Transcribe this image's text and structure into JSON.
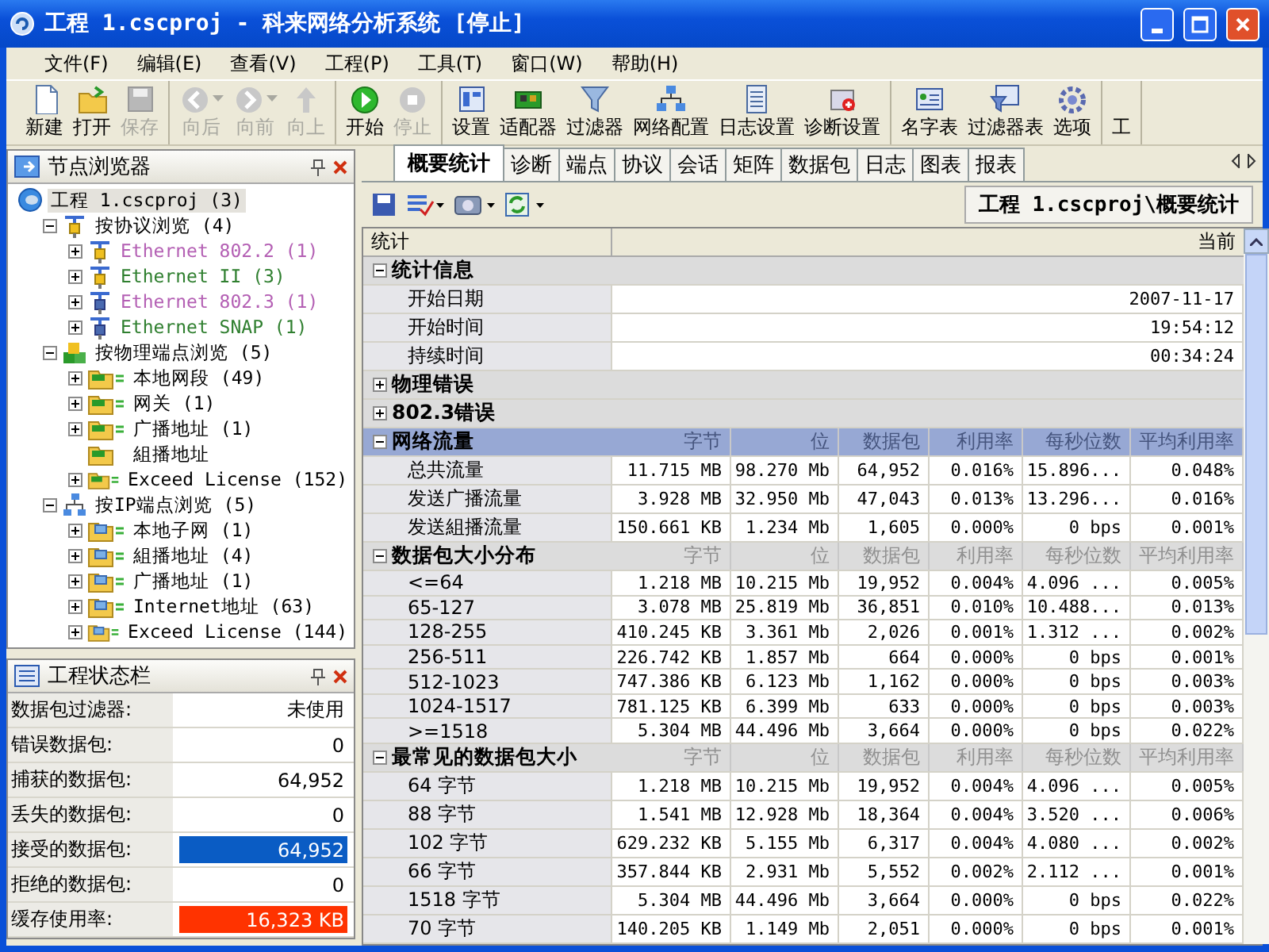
{
  "window": {
    "title": "工程 1.cscproj - 科来网络分析系统 [停止]"
  },
  "menu": [
    "文件(F)",
    "编辑(E)",
    "查看(V)",
    "工程(P)",
    "工具(T)",
    "窗口(W)",
    "帮助(H)"
  ],
  "toolbar": [
    [
      {
        "label": "新建",
        "kind": "new",
        "disabled": false,
        "dropdown": false
      },
      {
        "label": "打开",
        "kind": "open",
        "disabled": false,
        "dropdown": false
      },
      {
        "label": "保存",
        "kind": "save",
        "disabled": true,
        "dropdown": false
      }
    ],
    [
      {
        "label": "向后",
        "kind": "back",
        "disabled": true,
        "dropdown": true
      },
      {
        "label": "向前",
        "kind": "forward",
        "disabled": true,
        "dropdown": true
      },
      {
        "label": "向上",
        "kind": "up",
        "disabled": true,
        "dropdown": false
      }
    ],
    [
      {
        "label": "开始",
        "kind": "start",
        "disabled": false,
        "dropdown": false
      },
      {
        "label": "停止",
        "kind": "stop",
        "disabled": true,
        "dropdown": false
      }
    ],
    [
      {
        "label": "设置",
        "kind": "settings",
        "disabled": false,
        "dropdown": false
      },
      {
        "label": "适配器",
        "kind": "adapter",
        "disabled": false,
        "dropdown": false
      },
      {
        "label": "过滤器",
        "kind": "filter",
        "disabled": false,
        "dropdown": false
      },
      {
        "label": "网络配置",
        "kind": "network",
        "disabled": false,
        "dropdown": false
      },
      {
        "label": "日志设置",
        "kind": "log",
        "disabled": false,
        "dropdown": false
      },
      {
        "label": "诊断设置",
        "kind": "diagnosis",
        "disabled": false,
        "dropdown": false
      }
    ],
    [
      {
        "label": "名字表",
        "kind": "names",
        "disabled": false,
        "dropdown": false
      },
      {
        "label": "过滤器表",
        "kind": "filtertable",
        "disabled": false,
        "dropdown": false
      },
      {
        "label": "选项",
        "kind": "options",
        "disabled": false,
        "dropdown": false
      }
    ],
    [
      {
        "label": "工",
        "kind": "none",
        "disabled": false,
        "dropdown": false
      }
    ]
  ],
  "node_browser": {
    "title": "节点浏览器",
    "nodes": [
      {
        "label": "工程 1.cscproj (3)",
        "kind": "project",
        "selected": true,
        "children": [
          {
            "label": "按协议浏览 (4)",
            "kind": "protocol",
            "expanded": true,
            "selected": false,
            "children": [
              {
                "label": "Ethernet 802.2 (1)",
                "kind": "protocol",
                "color": "#b460b4",
                "expanded": false,
                "selected": false
              },
              {
                "label": "Ethernet II (3)",
                "kind": "protocol",
                "color": "#2f7f2f",
                "expanded": false,
                "selected": false
              },
              {
                "label": "Ethernet 802.3 (1)",
                "kind": "protocol-blue",
                "color": "#b460b4",
                "expanded": false,
                "selected": false
              },
              {
                "label": "Ethernet SNAP (1)",
                "kind": "protocol-blue",
                "color": "#2f7f2f",
                "expanded": false,
                "selected": false
              }
            ]
          },
          {
            "label": "按物理端点浏览 (5)",
            "kind": "physical",
            "expanded": true,
            "selected": false,
            "children": [
              {
                "label": "本地网段 (49)",
                "kind": "board-folder",
                "expanded": false,
                "selected": false
              },
              {
                "label": "网关 (1)",
                "kind": "board-folder",
                "expanded": false,
                "selected": false
              },
              {
                "label": "广播地址 (1)",
                "kind": "board-folder",
                "expanded": false,
                "selected": false
              },
              {
                "label": "組播地址",
                "kind": "board-folder-plain",
                "selected": false
              },
              {
                "label": "Exceed License (152)",
                "kind": "board-folder",
                "expanded": false,
                "selected": false
              }
            ]
          },
          {
            "label": "按IP端点浏览 (5)",
            "kind": "ip",
            "expanded": true,
            "selected": false,
            "children": [
              {
                "label": "本地子网 (1)",
                "kind": "pc-folder",
                "expanded": false,
                "selected": false
              },
              {
                "label": "組播地址 (4)",
                "kind": "pc-folder",
                "expanded": false,
                "selected": false
              },
              {
                "label": "广播地址 (1)",
                "kind": "pc-folder",
                "expanded": false,
                "selected": false
              },
              {
                "label": "Internet地址 (63)",
                "kind": "pc-folder",
                "expanded": false,
                "selected": false
              },
              {
                "label": "Exceed License (144)",
                "kind": "pc-folder",
                "expanded": false,
                "selected": false
              }
            ]
          }
        ]
      }
    ]
  },
  "status_panel": {
    "title": "工程状态栏",
    "rows": [
      {
        "label": "数据包过滤器:",
        "value": "未使用"
      },
      {
        "label": "错误数据包:",
        "value": "0"
      },
      {
        "label": "捕获的数据包:",
        "value": "64,952"
      },
      {
        "label": "丢失的数据包:",
        "value": "0"
      },
      {
        "label": "接受的数据包:",
        "value": "64,952",
        "color": "#0a5cc4"
      },
      {
        "label": "拒绝的数据包:",
        "value": "0"
      },
      {
        "label": "缓存使用率:",
        "value": "16,323 KB",
        "color": "#ff3300"
      }
    ]
  },
  "tabs": [
    {
      "label": "概要统计",
      "selected": true
    },
    {
      "label": "诊断",
      "selected": false
    },
    {
      "label": "端点",
      "selected": false
    },
    {
      "label": "协议",
      "selected": false
    },
    {
      "label": "会话",
      "selected": false
    },
    {
      "label": "矩阵",
      "selected": false
    },
    {
      "label": "数据包",
      "selected": false
    },
    {
      "label": "日志",
      "selected": false
    },
    {
      "label": "图表",
      "selected": false
    },
    {
      "label": "报表",
      "selected": false
    }
  ],
  "breadcrumb": "工程 1.cscproj\\概要统计",
  "table": {
    "columns": [
      "统计",
      "当前"
    ],
    "groups": [
      {
        "label": "统计信息",
        "kind": "info",
        "expanded": true,
        "selected": false,
        "rows": [
          {
            "name": "开始日期",
            "values": [
              "2007-11-17"
            ]
          },
          {
            "name": "开始时间",
            "values": [
              "19:54:12"
            ]
          },
          {
            "name": "持续时间",
            "values": [
              "00:34:24"
            ]
          }
        ]
      },
      {
        "label": "物理错误",
        "kind": "info",
        "expanded": false,
        "selected": false
      },
      {
        "label": "802.3错误",
        "kind": "info",
        "expanded": false,
        "selected": false
      },
      {
        "label": "网络流量",
        "kind": "metrics",
        "expanded": true,
        "selected": true,
        "headers": [
          "字节",
          "位",
          "数据包",
          "利用率",
          "每秒位数",
          "平均利用率"
        ],
        "rows": [
          {
            "name": "总共流量",
            "values": [
              "11.715 MB",
              "98.270 Mb",
              "64,952",
              "0.016%",
              "15.896...",
              "0.048%"
            ]
          },
          {
            "name": "发送广播流量",
            "values": [
              "3.928 MB",
              "32.950 Mb",
              "47,043",
              "0.013%",
              "13.296...",
              "0.016%"
            ]
          },
          {
            "name": "发送組播流量",
            "values": [
              "150.661 KB",
              "1.234 Mb",
              "1,605",
              "0.000%",
              "0 bps",
              "0.001%"
            ]
          }
        ]
      },
      {
        "label": "数据包大小分布",
        "kind": "metrics",
        "expanded": true,
        "selected": false,
        "headers": [
          "字节",
          "位",
          "数据包",
          "利用率",
          "每秒位数",
          "平均利用率"
        ],
        "rows": [
          {
            "name": "<=64",
            "values": [
              "1.218 MB",
              "10.215 Mb",
              "19,952",
              "0.004%",
              "4.096 ...",
              "0.005%"
            ]
          },
          {
            "name": "65-127",
            "values": [
              "3.078 MB",
              "25.819 Mb",
              "36,851",
              "0.010%",
              "10.488...",
              "0.013%"
            ]
          },
          {
            "name": "128-255",
            "values": [
              "410.245 KB",
              "3.361 Mb",
              "2,026",
              "0.001%",
              "1.312 ...",
              "0.002%"
            ]
          },
          {
            "name": "256-511",
            "values": [
              "226.742 KB",
              "1.857 Mb",
              "664",
              "0.000%",
              "0 bps",
              "0.001%"
            ]
          },
          {
            "name": "512-1023",
            "values": [
              "747.386 KB",
              "6.123 Mb",
              "1,162",
              "0.000%",
              "0 bps",
              "0.003%"
            ]
          },
          {
            "name": "1024-1517",
            "values": [
              "781.125 KB",
              "6.399 Mb",
              "633",
              "0.000%",
              "0 bps",
              "0.003%"
            ]
          },
          {
            "name": ">=1518",
            "values": [
              "5.304 MB",
              "44.496 Mb",
              "3,664",
              "0.000%",
              "0 bps",
              "0.022%"
            ]
          }
        ]
      },
      {
        "label": "最常见的数据包大小",
        "kind": "metrics",
        "expanded": true,
        "selected": false,
        "headers": [
          "字节",
          "位",
          "数据包",
          "利用率",
          "每秒位数",
          "平均利用率"
        ],
        "rows": [
          {
            "name": "64 字节",
            "values": [
              "1.218 MB",
              "10.215 Mb",
              "19,952",
              "0.004%",
              "4.096 ...",
              "0.005%"
            ]
          },
          {
            "name": "88 字节",
            "values": [
              "1.541 MB",
              "12.928 Mb",
              "18,364",
              "0.004%",
              "3.520 ...",
              "0.006%"
            ]
          },
          {
            "name": "102 字节",
            "values": [
              "629.232 KB",
              "5.155 Mb",
              "6,317",
              "0.004%",
              "4.080 ...",
              "0.002%"
            ]
          },
          {
            "name": "66 字节",
            "values": [
              "357.844 KB",
              "2.931 Mb",
              "5,552",
              "0.002%",
              "2.112 ...",
              "0.001%"
            ]
          },
          {
            "name": "1518 字节",
            "values": [
              "5.304 MB",
              "44.496 Mb",
              "3,664",
              "0.000%",
              "0 bps",
              "0.022%"
            ]
          },
          {
            "name": "70 字节",
            "values": [
              "140.205 KB",
              "1.149 Mb",
              "2,051",
              "0.000%",
              "0 bps",
              "0.001%"
            ]
          }
        ]
      }
    ]
  }
}
